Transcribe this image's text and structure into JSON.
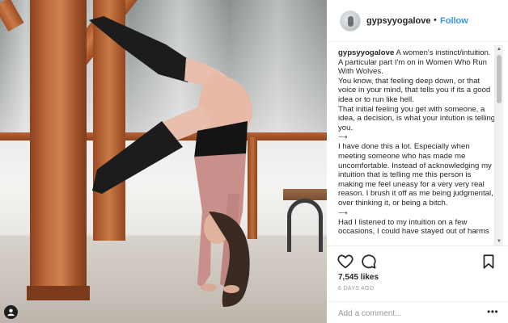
{
  "post": {
    "username": "gypsyyogalove",
    "dot": "•",
    "follow_label": "Follow"
  },
  "caption": {
    "username": "gypsyyogalove",
    "paragraphs": [
      {
        "text": "A women's instinct/intuition. A particular part I'm on in Women Who Run With Wolves."
      },
      {
        "text": "You know, that feeling deep down, or that voice in your mind, that tells you if its a good idea or to run like hell."
      },
      {
        "text": "That initial feeling you get with someone, a idea, a decision, is what your intution is telling you."
      },
      {
        "text": "⟶"
      },
      {
        "text": "I have done this a lot. Especially when meeting someone who has made me uncomfortable. Instead of acknowledging my intuition that is telling me this person is making me feel uneasy for a very very real reason. I brush it off as me being judgmental, over thinking it, or being a bitch."
      },
      {
        "text": "⟶"
      },
      {
        "text": "Had I listened to my intuition on a few occasions, I could have stayed out of harms"
      }
    ]
  },
  "stats": {
    "likes": "7,545 likes",
    "time_ago": "6 DAYS AGO"
  },
  "comment": {
    "placeholder": "Add a comment...",
    "more": "•••"
  },
  "icons": {
    "heart": "heart-icon",
    "comment": "comment-icon",
    "bookmark": "bookmark-icon",
    "user_tag": "user-tag-icon"
  },
  "colors": {
    "follow": "#3897f0",
    "text": "#262626",
    "muted": "#999999"
  }
}
